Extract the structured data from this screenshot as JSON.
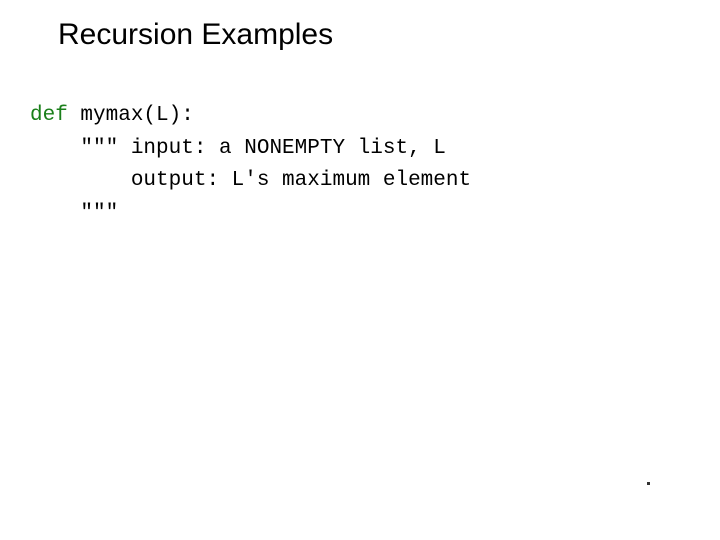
{
  "title": "Recursion Examples",
  "code": {
    "kw_def": "def",
    "sig": " mymax(L):",
    "doc_open": "    \"\"\" ",
    "doc_line1": "input: a NONEMPTY list, L",
    "doc_indent": "        ",
    "doc_line2": "output: L's maximum element",
    "doc_close": "    \"\"\""
  }
}
